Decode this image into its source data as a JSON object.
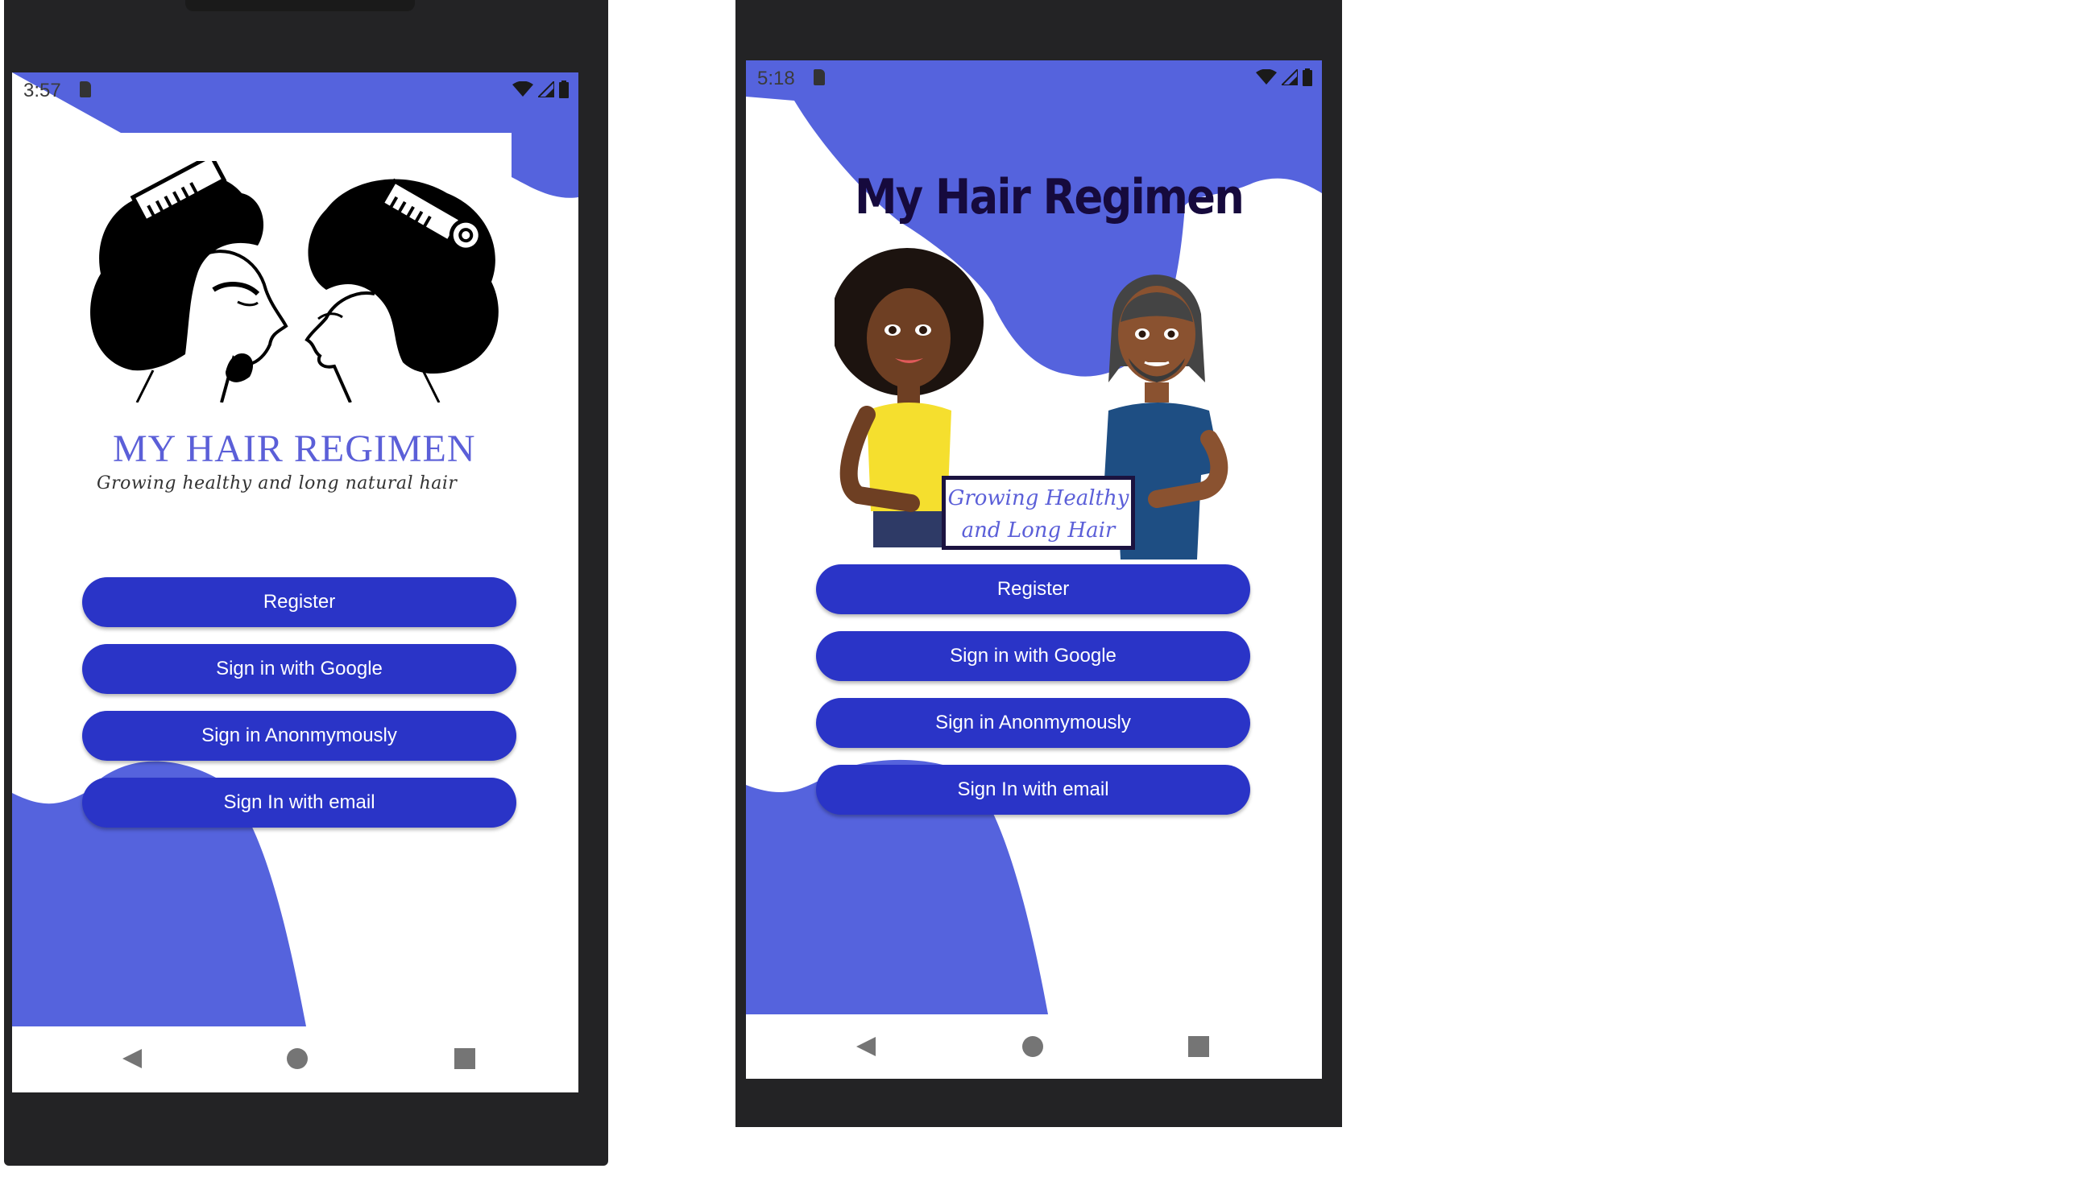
{
  "colors": {
    "accent_blob": "#5563dd",
    "button": "#2a34c7",
    "button_text": "#ffffff",
    "device_frame": "#232325",
    "brand_light": "#5b5fd8",
    "brand_dark": "#160a3d"
  },
  "left_phone": {
    "status": {
      "time": "3:57"
    },
    "brand": {
      "title": "MY HAIR REGIMEN",
      "tagline": "Growing healthy and long natural hair"
    },
    "buttons": [
      {
        "label": "Register"
      },
      {
        "label": "Sign in with Google"
      },
      {
        "label": "Sign in Anonmymously"
      },
      {
        "label": "Sign In with email"
      }
    ],
    "nav": {
      "back_icon": "back-triangle-icon",
      "home_icon": "home-circle-icon",
      "recents_icon": "recents-square-icon"
    }
  },
  "right_phone": {
    "status": {
      "time": "5:18"
    },
    "brand": {
      "title": "My Hair Regimen",
      "sign_line1": "Growing Healthy",
      "sign_line2": "and Long Hair"
    },
    "buttons": [
      {
        "label": "Register"
      },
      {
        "label": "Sign in with Google"
      },
      {
        "label": "Sign in Anonmymously"
      },
      {
        "label": "Sign In with email"
      }
    ],
    "nav": {
      "back_icon": "back-triangle-icon",
      "home_icon": "home-circle-icon",
      "recents_icon": "recents-square-icon"
    }
  }
}
